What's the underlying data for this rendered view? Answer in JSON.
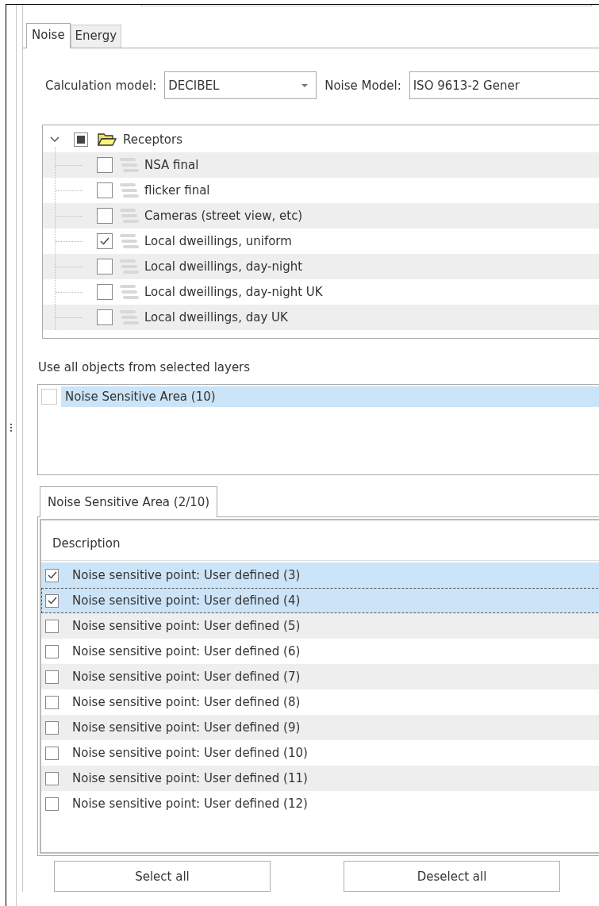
{
  "tabs": [
    {
      "label": "Noise",
      "selected": true
    },
    {
      "label": "Energy",
      "selected": false
    }
  ],
  "calculation_model": {
    "label": "Calculation model:",
    "value": "DECIBEL"
  },
  "noise_model": {
    "label": "Noise Model:",
    "value": "ISO 9613-2 Gener"
  },
  "layer_tree": {
    "label": "Receptors",
    "expanded": true,
    "checked": false,
    "partial": true,
    "children": [
      {
        "label": "NSA final",
        "checked": false
      },
      {
        "label": "flicker final",
        "checked": false
      },
      {
        "label": "Cameras (street view, etc)",
        "checked": false
      },
      {
        "label": "Local dweillings, uniform",
        "checked": true
      },
      {
        "label": "Local dweillings, day-night",
        "checked": false
      },
      {
        "label": "Local dweillings, day-night UK",
        "checked": false
      },
      {
        "label": "Local dweillings, day UK",
        "checked": false
      }
    ]
  },
  "layers_label": "Use all objects from selected layers",
  "layers": [
    {
      "label": "Noise Sensitive Area (10)",
      "checked": false,
      "selected": true
    }
  ],
  "object_tabs": [
    {
      "label": "Noise Sensitive Area (2/10)",
      "selected": true
    }
  ],
  "table": {
    "columns": [
      "Description"
    ],
    "rows": [
      {
        "text": "Noise sensitive point: User defined (3)",
        "checked": true,
        "selected": true,
        "focused": false
      },
      {
        "text": "Noise sensitive point: User defined (4)",
        "checked": true,
        "selected": true,
        "focused": true
      },
      {
        "text": "Noise sensitive point: User defined (5)",
        "checked": false,
        "selected": false,
        "focused": false
      },
      {
        "text": "Noise sensitive point: User defined (6)",
        "checked": false,
        "selected": false,
        "focused": false
      },
      {
        "text": "Noise sensitive point: User defined (7)",
        "checked": false,
        "selected": false,
        "focused": false
      },
      {
        "text": "Noise sensitive point: User defined (8)",
        "checked": false,
        "selected": false,
        "focused": false
      },
      {
        "text": "Noise sensitive point: User defined (9)",
        "checked": false,
        "selected": false,
        "focused": false
      },
      {
        "text": "Noise sensitive point: User defined (10)",
        "checked": false,
        "selected": false,
        "focused": false
      },
      {
        "text": "Noise sensitive point: User defined (11)",
        "checked": false,
        "selected": false,
        "focused": false
      },
      {
        "text": "Noise sensitive point: User defined (12)",
        "checked": false,
        "selected": false,
        "focused": false
      }
    ]
  },
  "buttons": [
    "Select all",
    "Deselect all"
  ]
}
